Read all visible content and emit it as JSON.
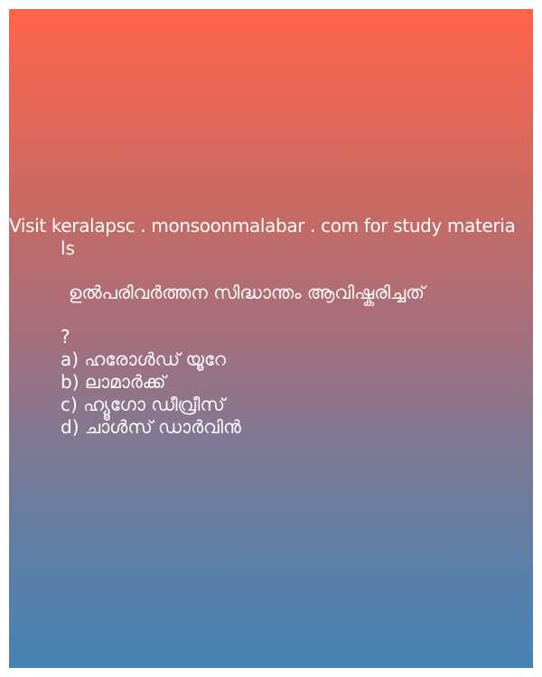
{
  "visit_text": {
    "line1": "Visit keralapsc . monsoonmalabar . com for study materia",
    "line2": "ls"
  },
  "question": "ഉൽപരിവർത്തന സിദ്ധാന്തം ആവിഷ്കരിച്ചത്",
  "question_mark": "?",
  "options": [
    "a) ഹരോൾഡ് യൂറേ",
    "b) ലാമാർക്ക്",
    "c) ഹ്യൂഗോ ഡീവ്രീസ്",
    "d) ചാൾസ് ഡാർവിൻ"
  ],
  "colors": {
    "gradient_top": "#ff644a",
    "gradient_bottom": "#4682b4",
    "text": "#ffffff"
  }
}
